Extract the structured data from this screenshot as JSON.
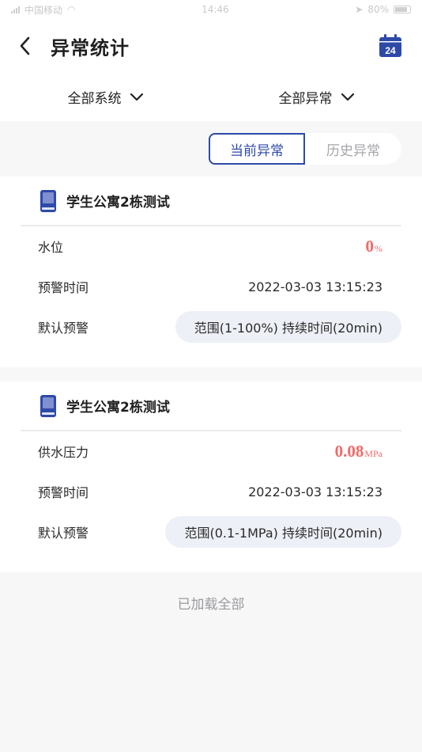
{
  "status": {
    "carrier": "中国移动",
    "time": "14:46",
    "battery": "80%"
  },
  "header": {
    "title": "异常统计",
    "calendar_day": "24"
  },
  "filters": [
    {
      "label": "全部系统"
    },
    {
      "label": "全部异常"
    }
  ],
  "tabs": [
    {
      "label": "当前异常",
      "active": true
    },
    {
      "label": "历史异常",
      "active": false
    }
  ],
  "cards": [
    {
      "title": "学生公寓2栋测试",
      "metric_label": "水位",
      "metric_value": "0",
      "metric_unit": "%",
      "time_label": "预警时间",
      "time_value": "2022-03-03 13:15:23",
      "rule_label": "默认预警",
      "rule_value": "范围(1-100%) 持续时间(20min)"
    },
    {
      "title": "学生公寓2栋测试",
      "metric_label": "供水压力",
      "metric_value": "0.08",
      "metric_unit": "MPa",
      "time_label": "预警时间",
      "time_value": "2022-03-03 13:15:23",
      "rule_label": "默认预警",
      "rule_value": "范围(0.1-1MPa) 持续时间(20min)"
    }
  ],
  "footer": {
    "text": "已加载全部"
  },
  "colors": {
    "accent": "#2e4aa8",
    "alert": "#ef6b6b"
  }
}
